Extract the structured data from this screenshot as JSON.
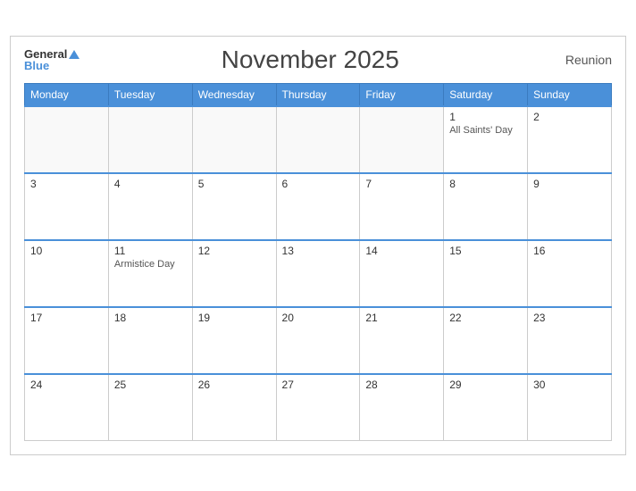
{
  "header": {
    "logo_general": "General",
    "logo_blue": "Blue",
    "title": "November 2025",
    "region": "Reunion"
  },
  "weekdays": [
    "Monday",
    "Tuesday",
    "Wednesday",
    "Thursday",
    "Friday",
    "Saturday",
    "Sunday"
  ],
  "weeks": [
    [
      {
        "day": "",
        "event": ""
      },
      {
        "day": "",
        "event": ""
      },
      {
        "day": "",
        "event": ""
      },
      {
        "day": "",
        "event": ""
      },
      {
        "day": "",
        "event": ""
      },
      {
        "day": "1",
        "event": "All Saints' Day"
      },
      {
        "day": "2",
        "event": ""
      }
    ],
    [
      {
        "day": "3",
        "event": ""
      },
      {
        "day": "4",
        "event": ""
      },
      {
        "day": "5",
        "event": ""
      },
      {
        "day": "6",
        "event": ""
      },
      {
        "day": "7",
        "event": ""
      },
      {
        "day": "8",
        "event": ""
      },
      {
        "day": "9",
        "event": ""
      }
    ],
    [
      {
        "day": "10",
        "event": ""
      },
      {
        "day": "11",
        "event": "Armistice Day"
      },
      {
        "day": "12",
        "event": ""
      },
      {
        "day": "13",
        "event": ""
      },
      {
        "day": "14",
        "event": ""
      },
      {
        "day": "15",
        "event": ""
      },
      {
        "day": "16",
        "event": ""
      }
    ],
    [
      {
        "day": "17",
        "event": ""
      },
      {
        "day": "18",
        "event": ""
      },
      {
        "day": "19",
        "event": ""
      },
      {
        "day": "20",
        "event": ""
      },
      {
        "day": "21",
        "event": ""
      },
      {
        "day": "22",
        "event": ""
      },
      {
        "day": "23",
        "event": ""
      }
    ],
    [
      {
        "day": "24",
        "event": ""
      },
      {
        "day": "25",
        "event": ""
      },
      {
        "day": "26",
        "event": ""
      },
      {
        "day": "27",
        "event": ""
      },
      {
        "day": "28",
        "event": ""
      },
      {
        "day": "29",
        "event": ""
      },
      {
        "day": "30",
        "event": ""
      }
    ]
  ]
}
